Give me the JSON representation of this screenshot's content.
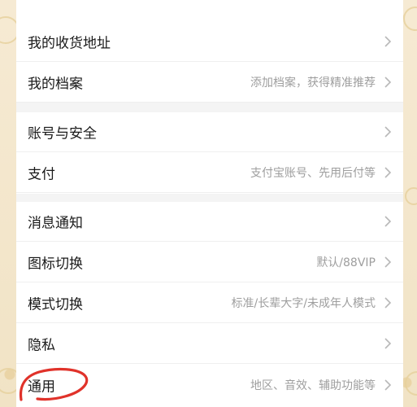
{
  "settings": {
    "items": [
      {
        "label": "我的收货地址",
        "hint": ""
      },
      {
        "label": "我的档案",
        "hint": "添加档案，获得精准推荐"
      },
      {
        "label": "账号与安全",
        "hint": ""
      },
      {
        "label": "支付",
        "hint": "支付宝账号、先用后付等"
      },
      {
        "label": "消息通知",
        "hint": ""
      },
      {
        "label": "图标切换",
        "hint": "默认/88VIP"
      },
      {
        "label": "模式切换",
        "hint": "标准/长辈大字/未成年人模式"
      },
      {
        "label": "隐私",
        "hint": ""
      },
      {
        "label": "通用",
        "hint": "地区、音效、辅助功能等"
      }
    ]
  },
  "colors": {
    "background": "#f3e7cd",
    "card": "#ffffff",
    "label": "#1a1a1a",
    "hint": "#9e9e9e",
    "annotation": "#e0322a"
  },
  "icons": {
    "chevron": "chevron-right-icon"
  }
}
